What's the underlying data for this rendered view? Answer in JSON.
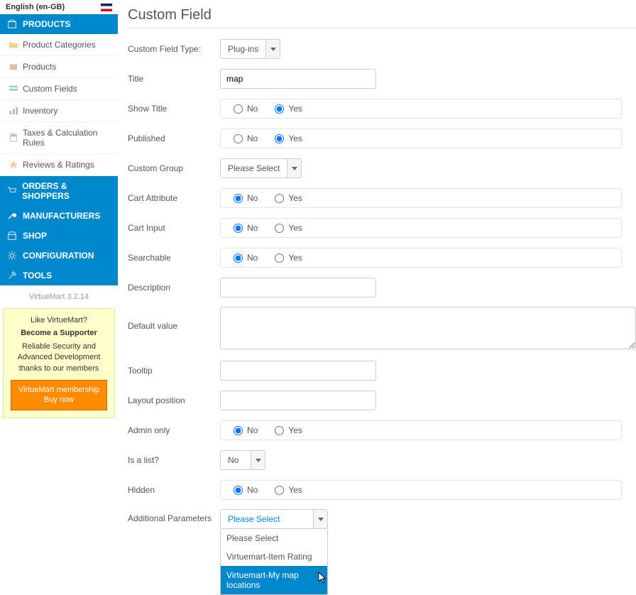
{
  "lang": {
    "label": "English (en-GB)"
  },
  "sidebar": {
    "sections": [
      {
        "label": "PRODUCTS",
        "items": [
          {
            "label": "Product Categories"
          },
          {
            "label": "Products"
          },
          {
            "label": "Custom Fields"
          },
          {
            "label": "Inventory"
          },
          {
            "label": "Taxes & Calculation Rules"
          },
          {
            "label": "Reviews & Ratings"
          }
        ]
      },
      {
        "label": "ORDERS & SHOPPERS",
        "items": []
      },
      {
        "label": "MANUFACTURERS",
        "items": []
      },
      {
        "label": "SHOP",
        "items": []
      },
      {
        "label": "CONFIGURATION",
        "items": []
      },
      {
        "label": "TOOLS",
        "items": []
      }
    ],
    "version": "VirtueMart 3.2.14",
    "promo": {
      "q": "Like VirtueMart?",
      "become": "Become a Supporter",
      "desc": "Reliable Security and Advanced Development thanks to our members",
      "buy": "VirtueMart membership Buy now"
    }
  },
  "page": {
    "title": "Custom Field"
  },
  "form": {
    "type": {
      "label": "Custom Field Type:",
      "value": "Plug-ins"
    },
    "title": {
      "label": "Title",
      "value": "map"
    },
    "show_title": {
      "label": "Show Title",
      "no": "No",
      "yes": "Yes",
      "selected": "Yes"
    },
    "published": {
      "label": "Published",
      "no": "No",
      "yes": "Yes",
      "selected": "Yes"
    },
    "group": {
      "label": "Custom Group",
      "value": "Please Select"
    },
    "cart_attr": {
      "label": "Cart Attribute",
      "no": "No",
      "yes": "Yes",
      "selected": "No"
    },
    "cart_input": {
      "label": "Cart Input",
      "no": "No",
      "yes": "Yes",
      "selected": "No"
    },
    "searchable": {
      "label": "Searchable",
      "no": "No",
      "yes": "Yes",
      "selected": "No"
    },
    "description": {
      "label": "Description",
      "value": ""
    },
    "default": {
      "label": "Default value",
      "value": ""
    },
    "tooltip": {
      "label": "Tooltip",
      "value": ""
    },
    "layout": {
      "label": "Layout position",
      "value": ""
    },
    "admin_only": {
      "label": "Admin only",
      "no": "No",
      "yes": "Yes",
      "selected": "No"
    },
    "is_list": {
      "label": "Is a list?",
      "value": "No"
    },
    "hidden": {
      "label": "Hidden",
      "no": "No",
      "yes": "Yes",
      "selected": "No"
    },
    "params": {
      "label": "Additional Parameters",
      "value": "Please Select",
      "options": [
        {
          "label": "Please Select",
          "hl": false
        },
        {
          "label": "Virtuemart-Item Rating",
          "hl": false
        },
        {
          "label": "Virtuemart-My map locations",
          "hl": true
        }
      ]
    }
  }
}
